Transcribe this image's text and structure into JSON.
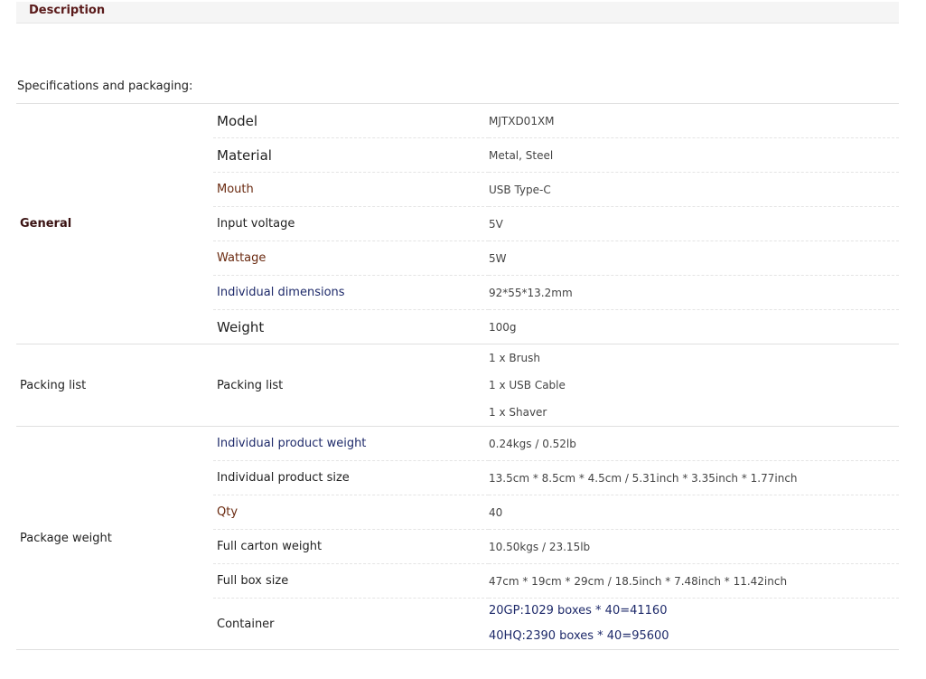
{
  "header": {
    "tab_label": "Description"
  },
  "spec_title": "Specifications and packaging:",
  "groups": {
    "general": {
      "label": "General",
      "rows": [
        {
          "name": "Model",
          "value": "MJTXD01XM"
        },
        {
          "name": "Material",
          "value": "Metal, Steel"
        },
        {
          "name": "Mouth",
          "value": "USB Type-C"
        },
        {
          "name": "Input voltage",
          "value": "5V"
        },
        {
          "name": "Wattage",
          "value": "5W"
        },
        {
          "name": "Individual dimensions",
          "value": "92*55*13.2mm"
        },
        {
          "name": "Weight",
          "value": "100g"
        }
      ]
    },
    "packing": {
      "label": "Packing list",
      "name": "Packing list",
      "items": [
        "1 x Brush",
        "1 x USB Cable",
        "1 x Shaver"
      ]
    },
    "package": {
      "label": "Package weight",
      "rows": [
        {
          "name": "Individual product weight",
          "value": "0.24kgs / 0.52lb"
        },
        {
          "name": "Individual product size",
          "value": "13.5cm * 8.5cm * 4.5cm / 5.31inch * 3.35inch * 1.77inch"
        },
        {
          "name": "Qty",
          "value": "40"
        },
        {
          "name": "Full carton weight",
          "value": "10.50kgs / 23.15lb"
        },
        {
          "name": "Full box size",
          "value": "47cm * 19cm * 29cm / 18.5inch * 7.48inch * 11.42inch"
        }
      ],
      "container": {
        "name": "Container",
        "values": [
          "20GP:1029 boxes * 40=41160",
          "40HQ:2390 boxes * 40=95600"
        ]
      }
    }
  }
}
